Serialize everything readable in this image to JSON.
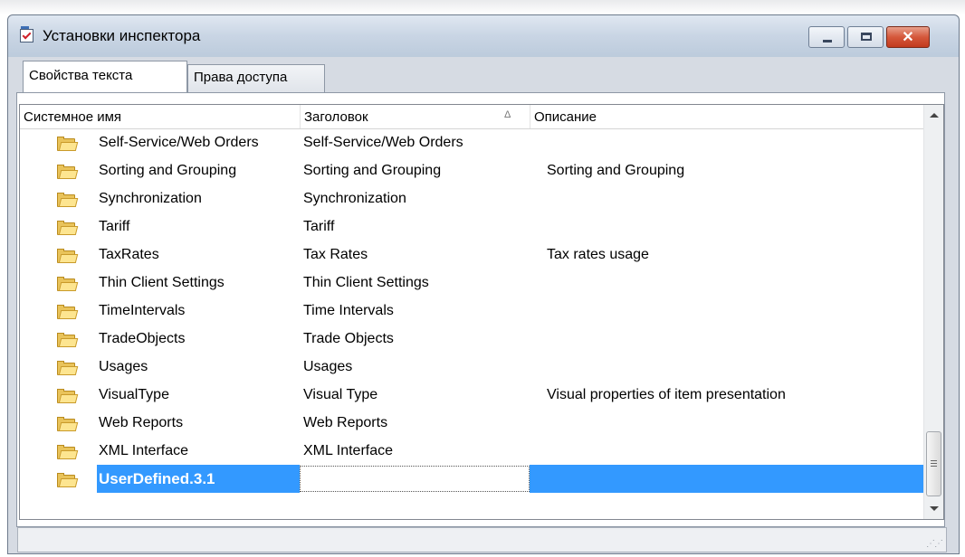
{
  "window": {
    "title": "Установки инспектора",
    "controls": {
      "minimize": "minimize",
      "maximize": "maximize",
      "close": "✕"
    }
  },
  "tabs": [
    {
      "label": "Свойства текста",
      "active": true
    },
    {
      "label": "Права доступа",
      "active": false
    }
  ],
  "list": {
    "columns": [
      {
        "label": "Системное имя"
      },
      {
        "label": "Заголовок",
        "sorted": "ascending"
      },
      {
        "label": "Описание"
      }
    ],
    "sort_indicator": "Δ",
    "rows": [
      {
        "name": "Self-Service/Web Orders",
        "title": "Self-Service/Web Orders",
        "description": ""
      },
      {
        "name": "Sorting and Grouping",
        "title": "Sorting and Grouping",
        "description": "Sorting and Grouping"
      },
      {
        "name": "Synchronization",
        "title": "Synchronization",
        "description": ""
      },
      {
        "name": "Tariff",
        "title": "Tariff",
        "description": ""
      },
      {
        "name": "TaxRates",
        "title": "Tax Rates",
        "description": "Tax rates usage"
      },
      {
        "name": "Thin Client Settings",
        "title": "Thin Client Settings",
        "description": ""
      },
      {
        "name": "TimeIntervals",
        "title": "Time Intervals",
        "description": ""
      },
      {
        "name": "TradeObjects",
        "title": "Trade Objects",
        "description": ""
      },
      {
        "name": "Usages",
        "title": "Usages",
        "description": ""
      },
      {
        "name": "VisualType",
        "title": "Visual Type",
        "description": "Visual properties of item presentation"
      },
      {
        "name": "Web Reports",
        "title": "Web Reports",
        "description": ""
      },
      {
        "name": "XML Interface",
        "title": "XML Interface",
        "description": ""
      },
      {
        "name": "UserDefined.3.1",
        "title": "",
        "description": "",
        "selected": true,
        "editing": true
      }
    ],
    "row_icon": "folder-icon",
    "selection_color": "#3399ff"
  },
  "statusbar": {
    "text": ""
  }
}
